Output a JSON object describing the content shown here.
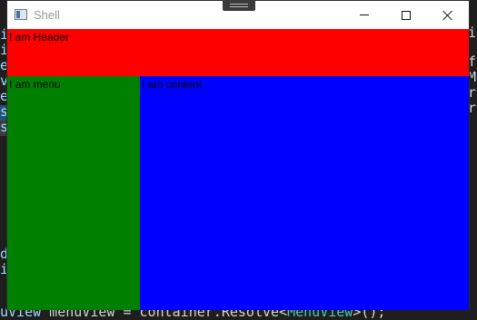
{
  "window": {
    "title": "Shell"
  },
  "regions": {
    "header": {
      "label": "I am Header",
      "color": "#ff0000"
    },
    "menu": {
      "label": "I am menu",
      "color": "#008000"
    },
    "content": {
      "label": "I am content",
      "color": "#0000ff"
    }
  },
  "editor_background": {
    "visible_code": "uView menuView = container.Resolve<MenuView>();",
    "code_parts": [
      "uView",
      " menuView = container.",
      "Resolve",
      "<",
      "MenuView",
      ">();"
    ]
  },
  "icons": {
    "app": "window-app-icon",
    "minimize": "minimize-icon",
    "maximize": "maximize-icon",
    "close": "close-icon"
  }
}
